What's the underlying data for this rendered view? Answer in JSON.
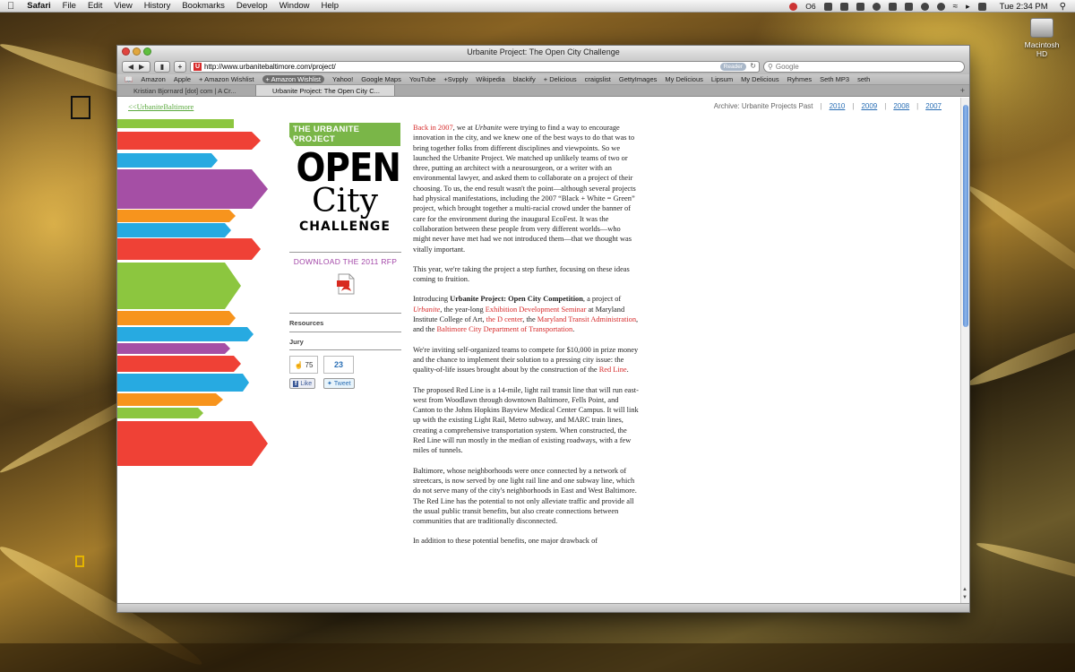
{
  "menubar": {
    "items": [
      "Safari",
      "File",
      "Edit",
      "View",
      "History",
      "Bookmarks",
      "Develop",
      "Window",
      "Help"
    ],
    "clock": "Tue 2:34 PM",
    "status_count": "O6"
  },
  "desktop": {
    "drive_label": "Macintosh HD"
  },
  "window": {
    "title": "Urbanite Project: The Open City Challenge",
    "url": "http://www.urbanitebaltimore.com/project/",
    "reader_label": "Reader",
    "search_placeholder": "Google",
    "bookmarks": [
      "Amazon",
      "Apple",
      "+ Amazon Wishlist",
      "+ Amazon Wishlist",
      "Yahoo!",
      "Google Maps",
      "YouTube",
      "+Svpply",
      "Wikipedia",
      "blackify",
      "+ Delicious",
      "craigslist",
      "GettyImages",
      "My Delicious",
      "Lipsum",
      "My Delicious",
      "Ryhmes",
      "Seth MP3",
      "seth"
    ],
    "tabs": [
      "Kristian Bjornard [dot] com | A Cr...",
      "Urbanite Project: The Open City C..."
    ]
  },
  "page": {
    "back_link": "<<UrbaniteBaltimore",
    "archive_label": "Archive: Urbanite Projects Past",
    "archive_years": [
      "2010",
      "2009",
      "2008",
      "2007"
    ],
    "logo": {
      "tag": "THE URBANITE PROJECT",
      "line1": "OPEN",
      "line2": "City",
      "line3": "CHALLENGE"
    },
    "download": "DOWNLOAD THE 2011 RFP",
    "resources": "Resources",
    "jury": "Jury",
    "like_count": "75",
    "tweet_count": "23",
    "like_label": "Like",
    "tweet_label": "Tweet",
    "colors": {
      "green": "#8cc63f",
      "red": "#ef4136",
      "blue": "#27aae1",
      "purple": "#a54fa5",
      "orange": "#f7941d"
    },
    "article": {
      "p1": [
        {
          "t": "Back in 2007",
          "c": "red"
        },
        {
          "t": ", we at "
        },
        {
          "t": "Urbanite",
          "c": "i"
        },
        {
          "t": " were trying to find a way to encourage innovation in the city, and we knew one of the best ways to do that was to bring together folks from different disciplines and viewpoints. So we launched the Urbanite Project. We matched up unlikely teams of two or three, putting an architect with a neurosurgeon, or a writer with an environmental lawyer, and asked them to collaborate on a project of their choosing. To us, the end result wasn't the point—although several projects had physical manifestations, including the 2007 “Black + White = Green” project, which brought together a multi-racial crowd under the banner of care for the environment during the inaugural EcoFest. It was the collaboration between these people from very different worlds—who might never have met had we not introduced them—that we thought was vitally important."
        }
      ],
      "p2": [
        {
          "t": "This year, we're taking the project a step further, focusing on these ideas coming to fruition."
        }
      ],
      "p3": [
        {
          "t": "Introducing "
        },
        {
          "t": "Urbanite Project: Open City Competition",
          "c": "b"
        },
        {
          "t": ", a project of "
        },
        {
          "t": "Urbanite",
          "c": "red i"
        },
        {
          "t": ", the year-long "
        },
        {
          "t": "Exhibition Development Seminar",
          "c": "red"
        },
        {
          "t": " at Maryland Institute College of Art, "
        },
        {
          "t": "the D center",
          "c": "red"
        },
        {
          "t": ", the "
        },
        {
          "t": "Maryland Transit Administration",
          "c": "red"
        },
        {
          "t": ", and the "
        },
        {
          "t": "Baltimore City Department of Transportation",
          "c": "red"
        },
        {
          "t": "."
        }
      ],
      "p4": [
        {
          "t": "We're inviting self-organized teams to compete for $10,000 in prize money and the chance to implement their solution to a pressing city issue: the quality-of-life issues brought about by the construction of the "
        },
        {
          "t": "Red Line",
          "c": "red"
        },
        {
          "t": "."
        }
      ],
      "p5": [
        {
          "t": "The proposed Red Line is a 14-mile, light rail transit line that will run east-west from Woodlawn through downtown Baltimore, Fells Point, and Canton to the Johns Hopkins Bayview Medical Center Campus. It will link up with the existing Light Rail, Metro subway, and MARC train lines, creating a comprehensive transportation system. When constructed, the Red Line will run mostly in the median of existing roadways, with a few miles of tunnels."
        }
      ],
      "p6": [
        {
          "t": "Baltimore, whose neighborhoods were once connected by a network of streetcars, is now served by one light rail line and one subway line, which do not serve many of the city's neighborhoods in East and West Baltimore. The Red Line has the potential to not only alleviate traffic and provide all the usual public transit benefits, but also create connections between communities that are traditionally disconnected."
        }
      ],
      "p7": [
        {
          "t": "In addition to these potential benefits, one major drawback of"
        }
      ]
    }
  }
}
